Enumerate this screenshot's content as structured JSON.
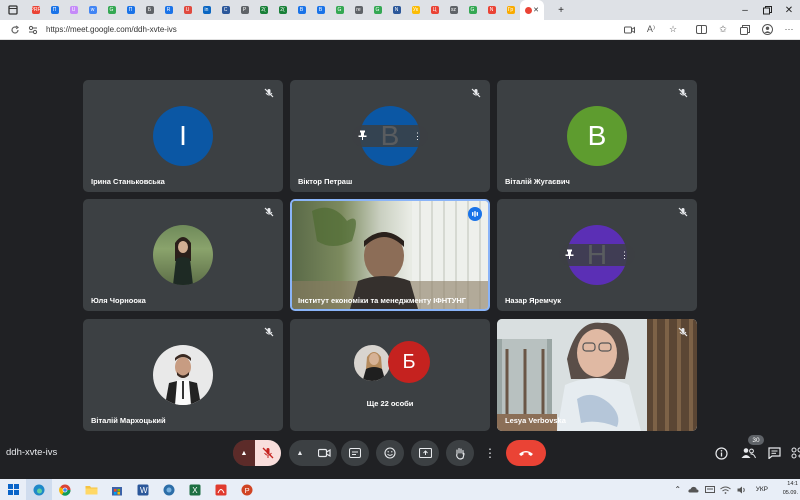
{
  "browser": {
    "url": "https://meet.google.com/ddh-xvte-ivs",
    "tab_labels": [
      "PRF",
      "П",
      "U",
      "w",
      "G",
      "П",
      "Б",
      "R",
      "U",
      "in",
      "C",
      "P",
      "2(",
      "2(",
      "B",
      "B",
      "G",
      "re",
      "G",
      "N",
      "Ук",
      "Ц",
      "sz",
      "G",
      "N",
      "Гр"
    ],
    "tab_colors": [
      "#ea4335",
      "#1a73e8",
      "#c58af9",
      "#4285f4",
      "#34a853",
      "#1a73e8",
      "#5f6368",
      "#1a73e8",
      "#e04a3f",
      "#0a66c2",
      "#2b579a",
      "#5f6368",
      "#188038",
      "#188038",
      "#1a73e8",
      "#1a73e8",
      "#34a853",
      "#5f6368",
      "#34a853",
      "#2b579a",
      "#fbbc04",
      "#ea4335",
      "#5f6368",
      "#34a853",
      "#ea4335",
      "#f9ab00"
    ]
  },
  "participants": [
    {
      "name": "Ірина Станьковська",
      "initial": "I",
      "color": "#0b57a4"
    },
    {
      "name": "Віктор Петраш",
      "initial": "B",
      "color": "#0b57a4"
    },
    {
      "name": "Віталій Жугаєвич",
      "initial": "B",
      "color": "#5e9c2f"
    },
    {
      "name": "Юля Чорноока"
    },
    {
      "name": "Інститут економіки та менеджменту ІФНТУНГ"
    },
    {
      "name": "Назар Яремчук",
      "initial": "H",
      "color": "#5b2fb5"
    },
    {
      "name": "Віталій Мархоцький"
    },
    {
      "more_label": "Ще 22 особи",
      "initial": "Б",
      "color": "#c5221f"
    },
    {
      "name": "Lesya Verbovska"
    }
  ],
  "meeting": {
    "code": "ddh-xvte-ivs",
    "participant_count": "30"
  },
  "taskbar": {
    "language": "УКР",
    "time": "14:1",
    "date": "05.09."
  },
  "colors": {
    "background": "#202124",
    "tile": "#3c4043",
    "end_call": "#ea4335",
    "mic_off": "#f9dedc",
    "active_speaker": "#8ab4f8"
  }
}
